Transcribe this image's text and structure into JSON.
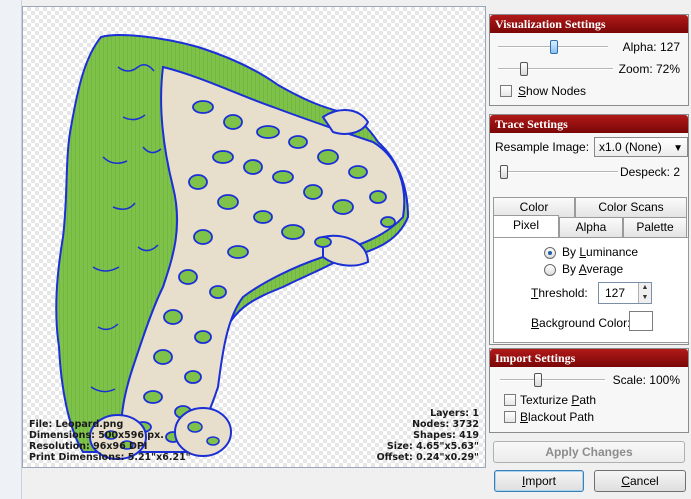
{
  "canvas": {
    "file_info": [
      "File: Leopard.png",
      "Dimensions: 500x596 px.",
      "Resolution: 96x96 DPI",
      "Print Dimensions: 5.21\"x6.21\""
    ],
    "trace_info": [
      "Layers: 1",
      "Nodes: 3732",
      "Shapes: 419",
      "Size: 4.65\"x5.63\"",
      "Offset: 0.24\"x0.29\""
    ]
  },
  "visualization": {
    "title": "Visualization Settings",
    "alpha_label": "Alpha: 127",
    "alpha_level": 0.5,
    "zoom_label": "Zoom: 72%",
    "zoom_level": 0.3,
    "show_nodes_label": "Show Nodes",
    "show_nodes_checked": false
  },
  "trace": {
    "title": "Trace Settings",
    "resample_label": "Resample Image:",
    "resample_value": "x1.0 (None)",
    "despeck_label": "Despeck: 2",
    "despeck_level": 0.02,
    "tabs_top": [
      "Color",
      "Color Scans"
    ],
    "tabs_bottom": [
      "Pixel",
      "Alpha",
      "Palette"
    ],
    "active_tab": "Pixel",
    "by_luminance": "By Luminance",
    "by_average": "By Average",
    "selected_mode": "By Luminance",
    "threshold_label": "Threshold:",
    "threshold_value": "127",
    "background_color_label": "Background Color:",
    "background_color": "#ffffff"
  },
  "import": {
    "title": "Import Settings",
    "scale_label": "Scale: 100%",
    "scale_level": 0.3,
    "texturize_label": "Texturize Path",
    "blackout_label": "Blackout Path",
    "apply_label": "Apply Changes",
    "import_label": "Import",
    "cancel_label": "Cancel"
  },
  "colors": {
    "panel_header": "#8e0b0b",
    "trace_fill": "#7ec24a",
    "trace_outline": "#1b2fd6",
    "spot_fill": "#e7dfcc"
  }
}
